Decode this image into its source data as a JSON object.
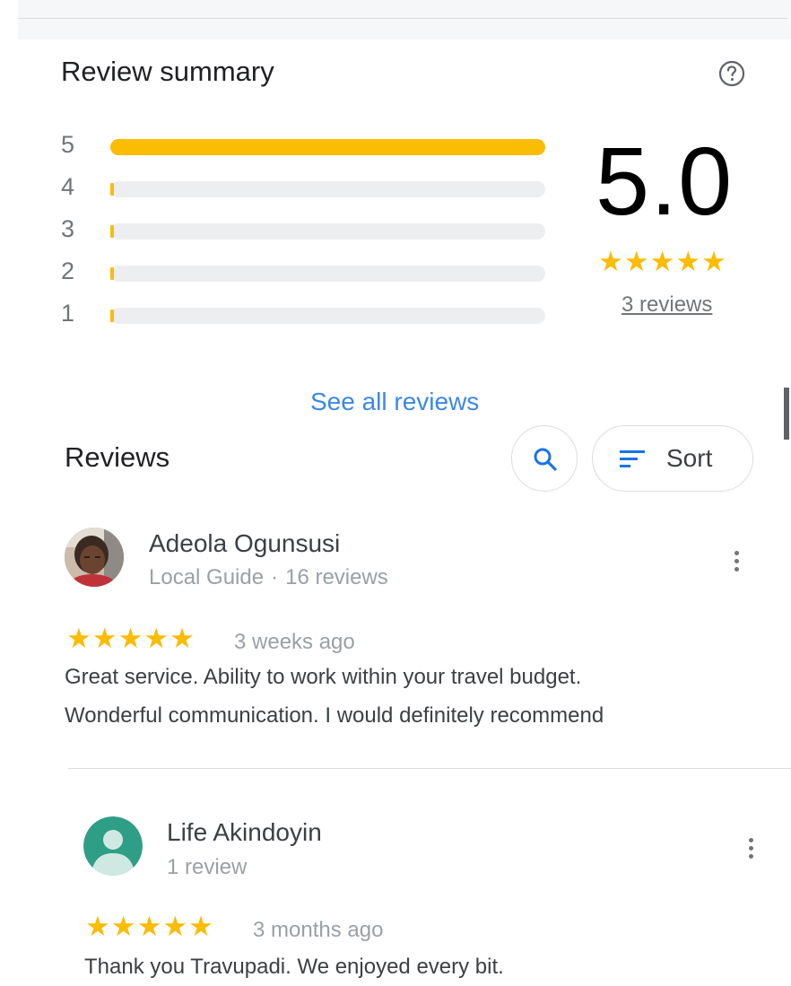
{
  "summary": {
    "title": "Review summary",
    "score": "5.0",
    "stars": "★★★★★",
    "review_count_link": "3 reviews",
    "distribution": [
      {
        "label": "5",
        "fraction": 1.0
      },
      {
        "label": "4",
        "fraction": 0.0
      },
      {
        "label": "3",
        "fraction": 0.0
      },
      {
        "label": "2",
        "fraction": 0.0
      },
      {
        "label": "1",
        "fraction": 0.0
      }
    ],
    "accent_color": "#fbbc04"
  },
  "see_all_label": "See all reviews",
  "reviews_section": {
    "heading": "Reviews",
    "sort_label": "Sort"
  },
  "reviews": [
    {
      "name": "Adeola Ogunsusi",
      "meta": "Local Guide",
      "meta_dot": "·",
      "meta_count": "16 reviews",
      "stars": "★★★★★",
      "time": "3 weeks ago",
      "text_line1": "Great service. Ability to work within your travel budget.",
      "text_line2": "Wonderful communication. I would definitely recommend",
      "avatar": "photo-avatar"
    },
    {
      "name": "Life Akindoyin",
      "meta": "1 review",
      "stars": "★★★★★",
      "time": "3 months ago",
      "text_line1": "Thank you Travupadi. We enjoyed every bit.",
      "avatar": "default-person-avatar",
      "avatar_color": "#2e9e86"
    }
  ]
}
